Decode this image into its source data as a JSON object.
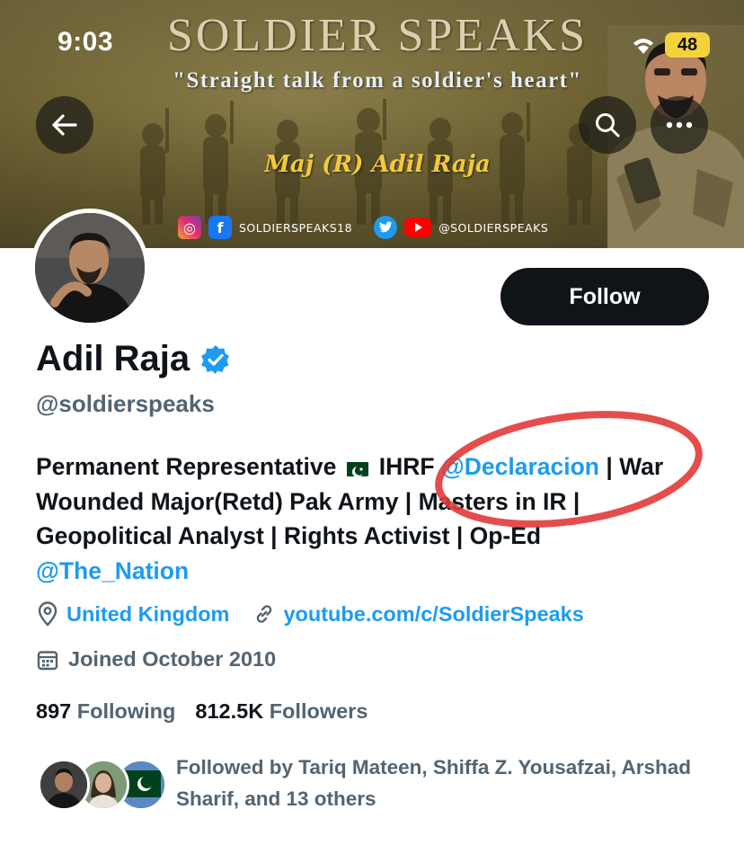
{
  "status_bar": {
    "time": "9:03",
    "battery": "48"
  },
  "banner": {
    "title": "SOLDIER SPEAKS",
    "tagline": "\"Straight talk from a soldier's heart\"",
    "name": "Maj (R) Adil Raja",
    "social": [
      {
        "label": "SOLDIERSPEAKS18"
      },
      {
        "label": "@SOLDIERSPEAKS"
      }
    ]
  },
  "controls": {
    "back": "back-arrow-icon",
    "search": "search-icon",
    "more": "more-icon"
  },
  "profile": {
    "follow_label": "Follow",
    "display_name": "Adil Raja",
    "handle": "@soldierspeaks",
    "bio": {
      "part1": "Permanent Representative",
      "part2": " IHRF ",
      "mention1": "@Declaracion",
      "part3": " | War Wounded Major(Retd) Pak Army | Masters in IR | Geopolitical Analyst | Rights Activist | Op-Ed ",
      "mention2": "@The_Nation"
    },
    "location": "United Kingdom",
    "website": "youtube.com/c/SoldierSpeaks",
    "joined": "Joined October 2010",
    "following_count": "897",
    "following_label": "Following",
    "followers_count": "812.5K",
    "followers_label": "Followers",
    "followed_by": "Followed by Tariq Mateen, Shiffa Z. Yousafzai, Arshad Sharif, and 13 others"
  },
  "colors": {
    "accent": "#1d9bf0",
    "annotation": "#e23a3a",
    "text": "#0f1419",
    "muted": "#536471"
  }
}
